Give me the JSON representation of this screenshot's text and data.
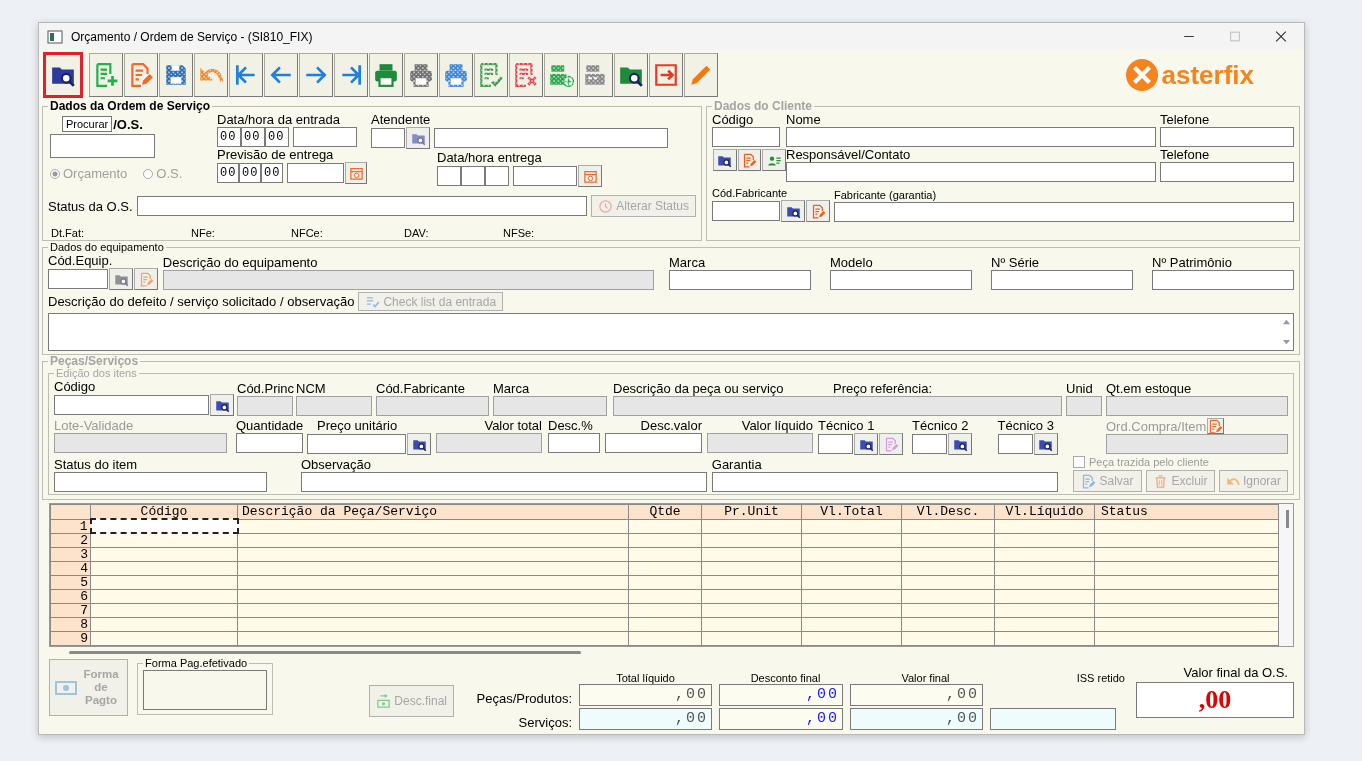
{
  "window": {
    "title": "Orçamento / Ordem de Serviço - (SI810_FIX)"
  },
  "toolbar": [
    {
      "kind": "folder-search",
      "color": "#2e3a9c",
      "disabled": false,
      "selected": true
    },
    {
      "kind": "doc-add",
      "color": "#1db34a",
      "disabled": false,
      "selected": false
    },
    {
      "kind": "doc-edit",
      "color": "#f06a2a",
      "disabled": false,
      "selected": false
    },
    {
      "kind": "save",
      "color": "#2f6fb0",
      "disabled": true,
      "selected": false
    },
    {
      "kind": "undo",
      "color": "#f08a2a",
      "disabled": true,
      "selected": false
    },
    {
      "kind": "first",
      "color": "#1f7fdd",
      "disabled": false,
      "selected": false
    },
    {
      "kind": "prev",
      "color": "#1f7fdd",
      "disabled": false,
      "selected": false
    },
    {
      "kind": "next",
      "color": "#1f7fdd",
      "disabled": false,
      "selected": false
    },
    {
      "kind": "last",
      "color": "#1f7fdd",
      "disabled": false,
      "selected": false
    },
    {
      "kind": "printer",
      "color": "#1e8a3a",
      "disabled": false,
      "selected": false
    },
    {
      "kind": "printer",
      "color": "#6f6f6f",
      "disabled": true,
      "selected": false
    },
    {
      "kind": "printer",
      "color": "#3f86d6",
      "disabled": true,
      "selected": false
    },
    {
      "kind": "doc-check",
      "color": "#3a9a4a",
      "disabled": true,
      "selected": false
    },
    {
      "kind": "doc-x",
      "color": "#e04050",
      "disabled": true,
      "selected": false
    },
    {
      "kind": "register-add",
      "color": "#2aa84a",
      "disabled": true,
      "selected": false
    },
    {
      "kind": "register",
      "color": "#888888",
      "disabled": true,
      "selected": false
    },
    {
      "kind": "folder-search",
      "color": "#1e8a3a",
      "disabled": false,
      "selected": false
    },
    {
      "kind": "exit",
      "color": "#e83a20",
      "disabled": false,
      "selected": false
    },
    {
      "kind": "pencil",
      "color": "#f07a10",
      "disabled": false,
      "selected": false
    }
  ],
  "tooltip": "Procurar",
  "logo": {
    "text": "asterfix"
  },
  "order": {
    "legend": "Dados da Ordem de Serviço",
    "number_label": "/O.S.",
    "modes": [
      {
        "label": "Orçamento",
        "selected": true,
        "disabled": true
      },
      {
        "label": "O.S.",
        "selected": false,
        "disabled": true
      }
    ],
    "entry_label": "Data/hora da entrada",
    "entry_time": [
      "00",
      "00",
      "00"
    ],
    "attendant_label": "Atendente",
    "forecast_label": "Previsão de entrega",
    "forecast_time": [
      "00",
      "00",
      "00"
    ],
    "delivery_label": "Data/hora entrega",
    "status_label": "Status da O.S.",
    "status_button": {
      "label": "Alterar Status",
      "disabled": true
    },
    "info": [
      "Dt.Fat:",
      "NFe:",
      "NFCe:",
      "DAV:",
      "NFSe:"
    ]
  },
  "client": {
    "legend": "Dados do Cliente",
    "code_label": "Código",
    "name_label": "Nome",
    "phone_label": "Telefone",
    "contact_label": "Responsável/Contato",
    "phone2_label": "Telefone",
    "maker_code_label": "Cód.Fabricante",
    "maker_label": "Fabricante (garantia)"
  },
  "equipment": {
    "legend": "Dados do equipamento",
    "labels": [
      "Cód.Equip.",
      "Descrição do equipamento",
      "Marca",
      "Modelo",
      "Nº Série",
      "Nº Patrimônio"
    ],
    "defect_label": "Descrição do defeito / serviço solicitado / observação",
    "checklist_button": {
      "label": "Check list da entrada",
      "disabled": true
    }
  },
  "parts": {
    "legend": "Peças/Serviços",
    "sub_legend": "Edição dos itens",
    "row1": [
      "Código",
      "Cód.Princ",
      "NCM",
      "Cód.Fabricante",
      "Marca",
      "Descrição da peça ou serviço",
      "Preço referência:",
      "Unid",
      "Qt.em estoque"
    ],
    "lot": {
      "label": "Lote-Validade",
      "disabled": true
    },
    "row2": [
      "Quantidade",
      "Preço unitário",
      "Valor total",
      "Desc.%",
      "Desc.valor",
      "Valor líquido",
      "Técnico 1",
      "Técnico 2",
      "Técnico 3"
    ],
    "order_item": {
      "label": "Ord.Compra/Item",
      "disabled": true
    },
    "client_part": {
      "label": "Peça trazida pelo cliente",
      "checked": false,
      "disabled": true
    },
    "row3": [
      "Status do item",
      "Observação",
      "Garantia"
    ],
    "buttons": [
      {
        "kind": "save",
        "label": "Salvar",
        "disabled": true
      },
      {
        "kind": "delete",
        "label": "Excluir",
        "disabled": true
      },
      {
        "kind": "undo",
        "label": "Ignorar",
        "disabled": true
      }
    ]
  },
  "table": {
    "columns": [
      "Código",
      "Descrição da Peça/Serviço",
      "Qtde",
      "Pr.Unit",
      "Vl.Total",
      "Vl.Desc.",
      "Vl.Líquido",
      "Status"
    ],
    "rows": [
      {
        "number": "1",
        "selected": true
      },
      {
        "number": "2",
        "selected": false
      },
      {
        "number": "3",
        "selected": false
      },
      {
        "number": "4",
        "selected": false
      },
      {
        "number": "5",
        "selected": false
      },
      {
        "number": "6",
        "selected": false
      },
      {
        "number": "7",
        "selected": false
      },
      {
        "number": "8",
        "selected": false
      },
      {
        "number": "9",
        "selected": false
      }
    ]
  },
  "footer": {
    "payment_button": {
      "label": "Forma de Pagto",
      "disabled": true
    },
    "payment_group": "Forma Pag.efetivado",
    "discount_button": {
      "label": "Desc.final",
      "disabled": true
    },
    "columns": [
      "Total líquido",
      "Desconto final",
      "Valor final"
    ],
    "rows": [
      {
        "label": "Peças/Produtos:",
        "values": [
          ",00",
          ",00",
          ",00"
        ]
      },
      {
        "label": "Serviços:",
        "values": [
          ",00",
          ",00",
          ",00"
        ]
      }
    ],
    "iss_label": "ISS retido",
    "final_label": "Valor final da O.S.",
    "final_value": ",00"
  }
}
